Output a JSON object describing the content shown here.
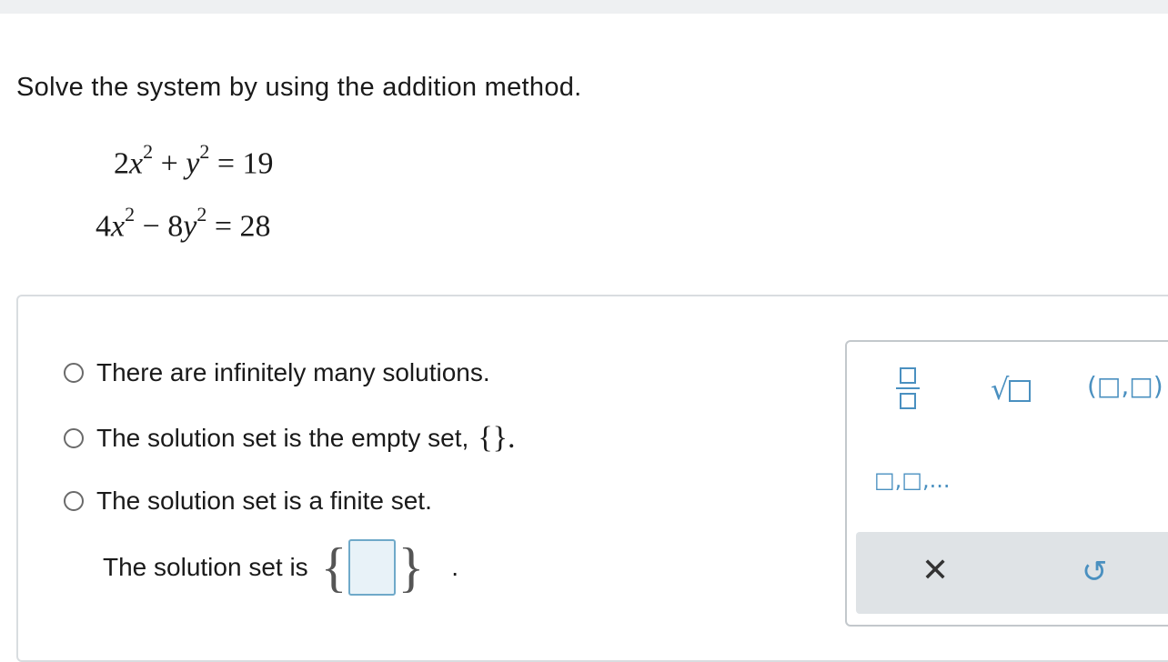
{
  "question": "Solve the system by using the addition method.",
  "equations": {
    "eq1": {
      "c1": "2",
      "v1": "x",
      "e1": "2",
      "op": "+",
      "c2": "",
      "v2": "y",
      "e2": "2",
      "rhs": "= 19"
    },
    "eq2": {
      "c1": "4",
      "v1": "x",
      "e1": "2",
      "op": "−",
      "c2": "8",
      "v2": "y",
      "e2": "2",
      "rhs": "= 28"
    }
  },
  "options": [
    {
      "label": "There are infinitely many solutions."
    },
    {
      "label": "The solution set is the empty set,",
      "symbol": "{}."
    },
    {
      "label": "The solution set is a finite set."
    }
  ],
  "answer": {
    "label": "The solution set is",
    "open_brace": "{",
    "close_brace": "}",
    "period": "."
  },
  "palette": {
    "sqrt_symbol": "√",
    "pair_label": "(□,□)",
    "list_label": "□,□,...",
    "clear_label": "✕",
    "undo_label": "↺",
    "accent_color": "#4a90c0"
  }
}
